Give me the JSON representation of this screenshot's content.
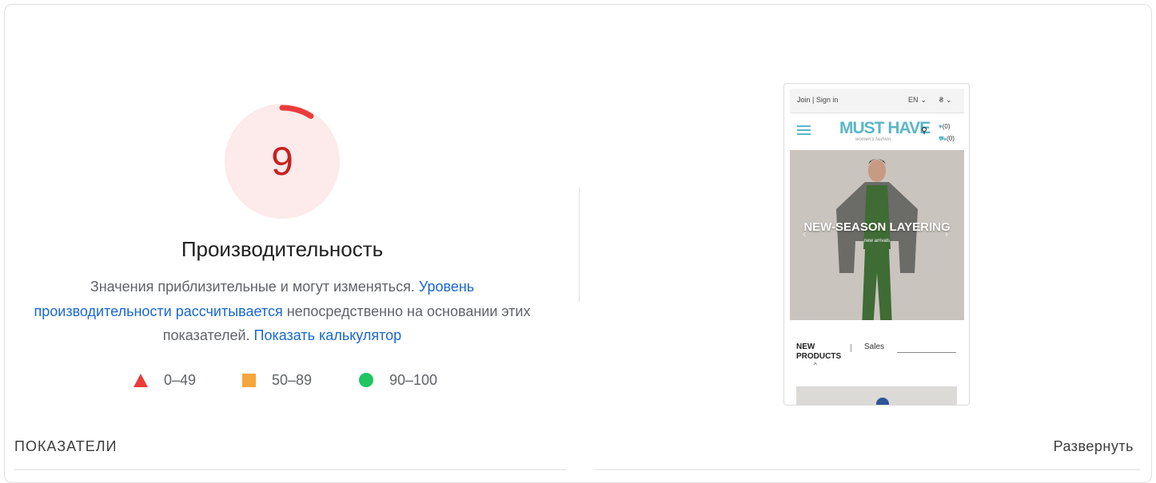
{
  "score": {
    "value": "9",
    "fraction": 0.09,
    "color": "#eb3b3b",
    "bg_color": "#fdecec",
    "text_color": "#c7221f"
  },
  "title": "Производительность",
  "description": {
    "part1": "Значения приблизительные и могут изменяться. ",
    "link1": "Уровень производительности рассчитывается",
    "part2": " непосредственно на основании этих показателей. ",
    "link2": "Показать калькулятор"
  },
  "legend": [
    {
      "range": "0–49",
      "shape": "triangle",
      "color": "#eb3b3b"
    },
    {
      "range": "50–89",
      "shape": "square",
      "color": "#f7a53b"
    },
    {
      "range": "90–100",
      "shape": "circle",
      "color": "#1ec562"
    }
  ],
  "screenshot": {
    "topbar": {
      "auth": "Join | Sign in",
      "lang": "EN",
      "currency": "₴"
    },
    "logo": "MUST HAVE",
    "logo_sub": "women's fashion",
    "wishlist": "(0)",
    "cart": "(0)",
    "hero_caption": "NEW-SEASON LAYERING",
    "hero_sub": "new arrivals",
    "tab_new": "NEW PRODUCTS",
    "tab_sales": "Sales"
  },
  "metrics_label": "ПОКАЗАТЕЛИ",
  "expand_label": "Развернуть"
}
